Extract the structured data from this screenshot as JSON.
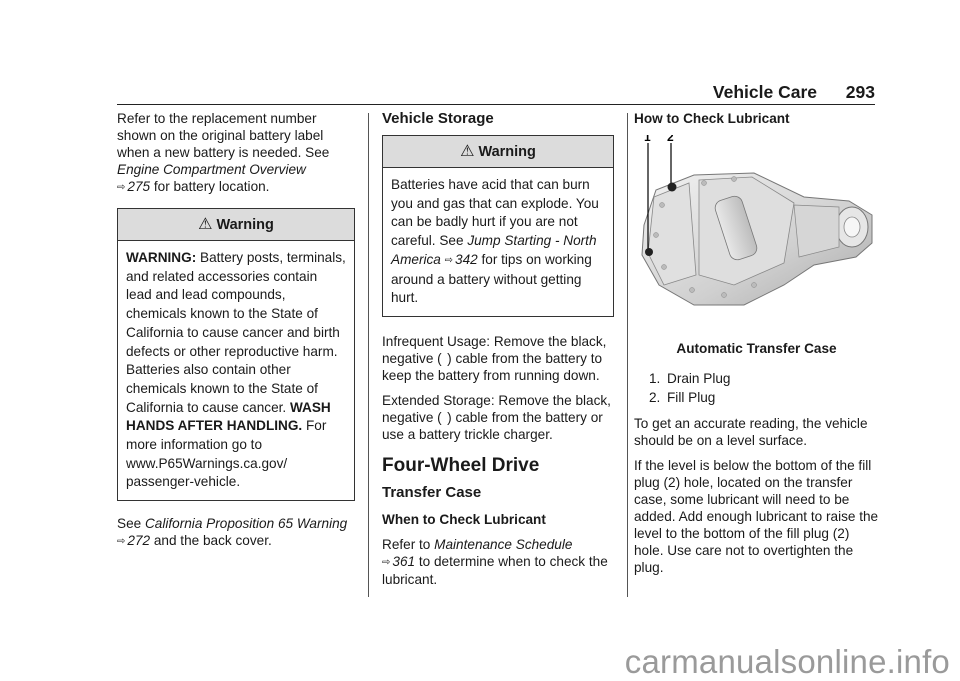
{
  "header": {
    "title": "Vehicle Care",
    "page_number": "293"
  },
  "col1": {
    "intro_lines": [
      "Refer to the replacement number",
      "shown on the original battery label",
      "when a new battery is needed. See"
    ],
    "intro_ref_title": "Engine Compartment Overview",
    "intro_ref_page": "275",
    "intro_tail": " for battery location.",
    "warning": {
      "title": "Warning",
      "lead_bold": "WARNING:",
      "body1": " Battery posts, terminals, and related accessories contain lead and lead compounds, chemicals known to the State of California to cause cancer and birth defects or other reproductive harm. Batteries also contain other chemicals known to the State of California to cause cancer. ",
      "bold2": "WASH HANDS AFTER HANDLING.",
      "body2": " For more information go to www.P65Warnings.ca.gov/ passenger-vehicle."
    },
    "see_prefix": "See ",
    "see_ref_title": "California Proposition 65 Warning",
    "see_ref_page": "272",
    "see_tail": " and the back cover."
  },
  "col2": {
    "section_title": "Vehicle Storage",
    "warning": {
      "title": "Warning",
      "body1": "Batteries have acid that can burn you and gas that can explode. You can be badly hurt if you are not careful. See ",
      "ref_title": "Jump Starting - North America",
      "ref_page": "342",
      "body2": " for tips on working around a battery without getting hurt."
    },
    "para_infrequent": "Infrequent Usage: Remove the black, negative (  ) cable from the battery to keep the battery from running down.",
    "para_extended": "Extended Storage: Remove the black, negative (  ) cable from the battery or use a battery trickle charger.",
    "chapter_title": "Four-Wheel Drive",
    "subsection_title": "Transfer Case",
    "subsub_title": "When to Check Lubricant",
    "refer_prefix": "Refer to ",
    "refer_title": "Maintenance Schedule",
    "refer_page": "361",
    "refer_tail": " to determine when to check the lubricant."
  },
  "col3": {
    "section_title": "How to Check Lubricant",
    "figure": {
      "callouts": [
        "1",
        "2"
      ],
      "caption": "Automatic Transfer Case",
      "legend": [
        {
          "num": "1.",
          "label": "Drain Plug"
        },
        {
          "num": "2.",
          "label": "Fill Plug"
        }
      ]
    },
    "para1": "To get an accurate reading, the vehicle should be on a level surface.",
    "para2": "If the level is below the bottom of the fill plug (2) hole, located on the transfer case, some lubricant will need to be added. Add enough lubricant to raise the level to the bottom of the fill plug (2) hole. Use care not to overtighten the plug."
  },
  "icons": {
    "ref_arrow": "⇨",
    "warning_triangle": "⚠"
  },
  "watermark": "carmanualsonline.info"
}
